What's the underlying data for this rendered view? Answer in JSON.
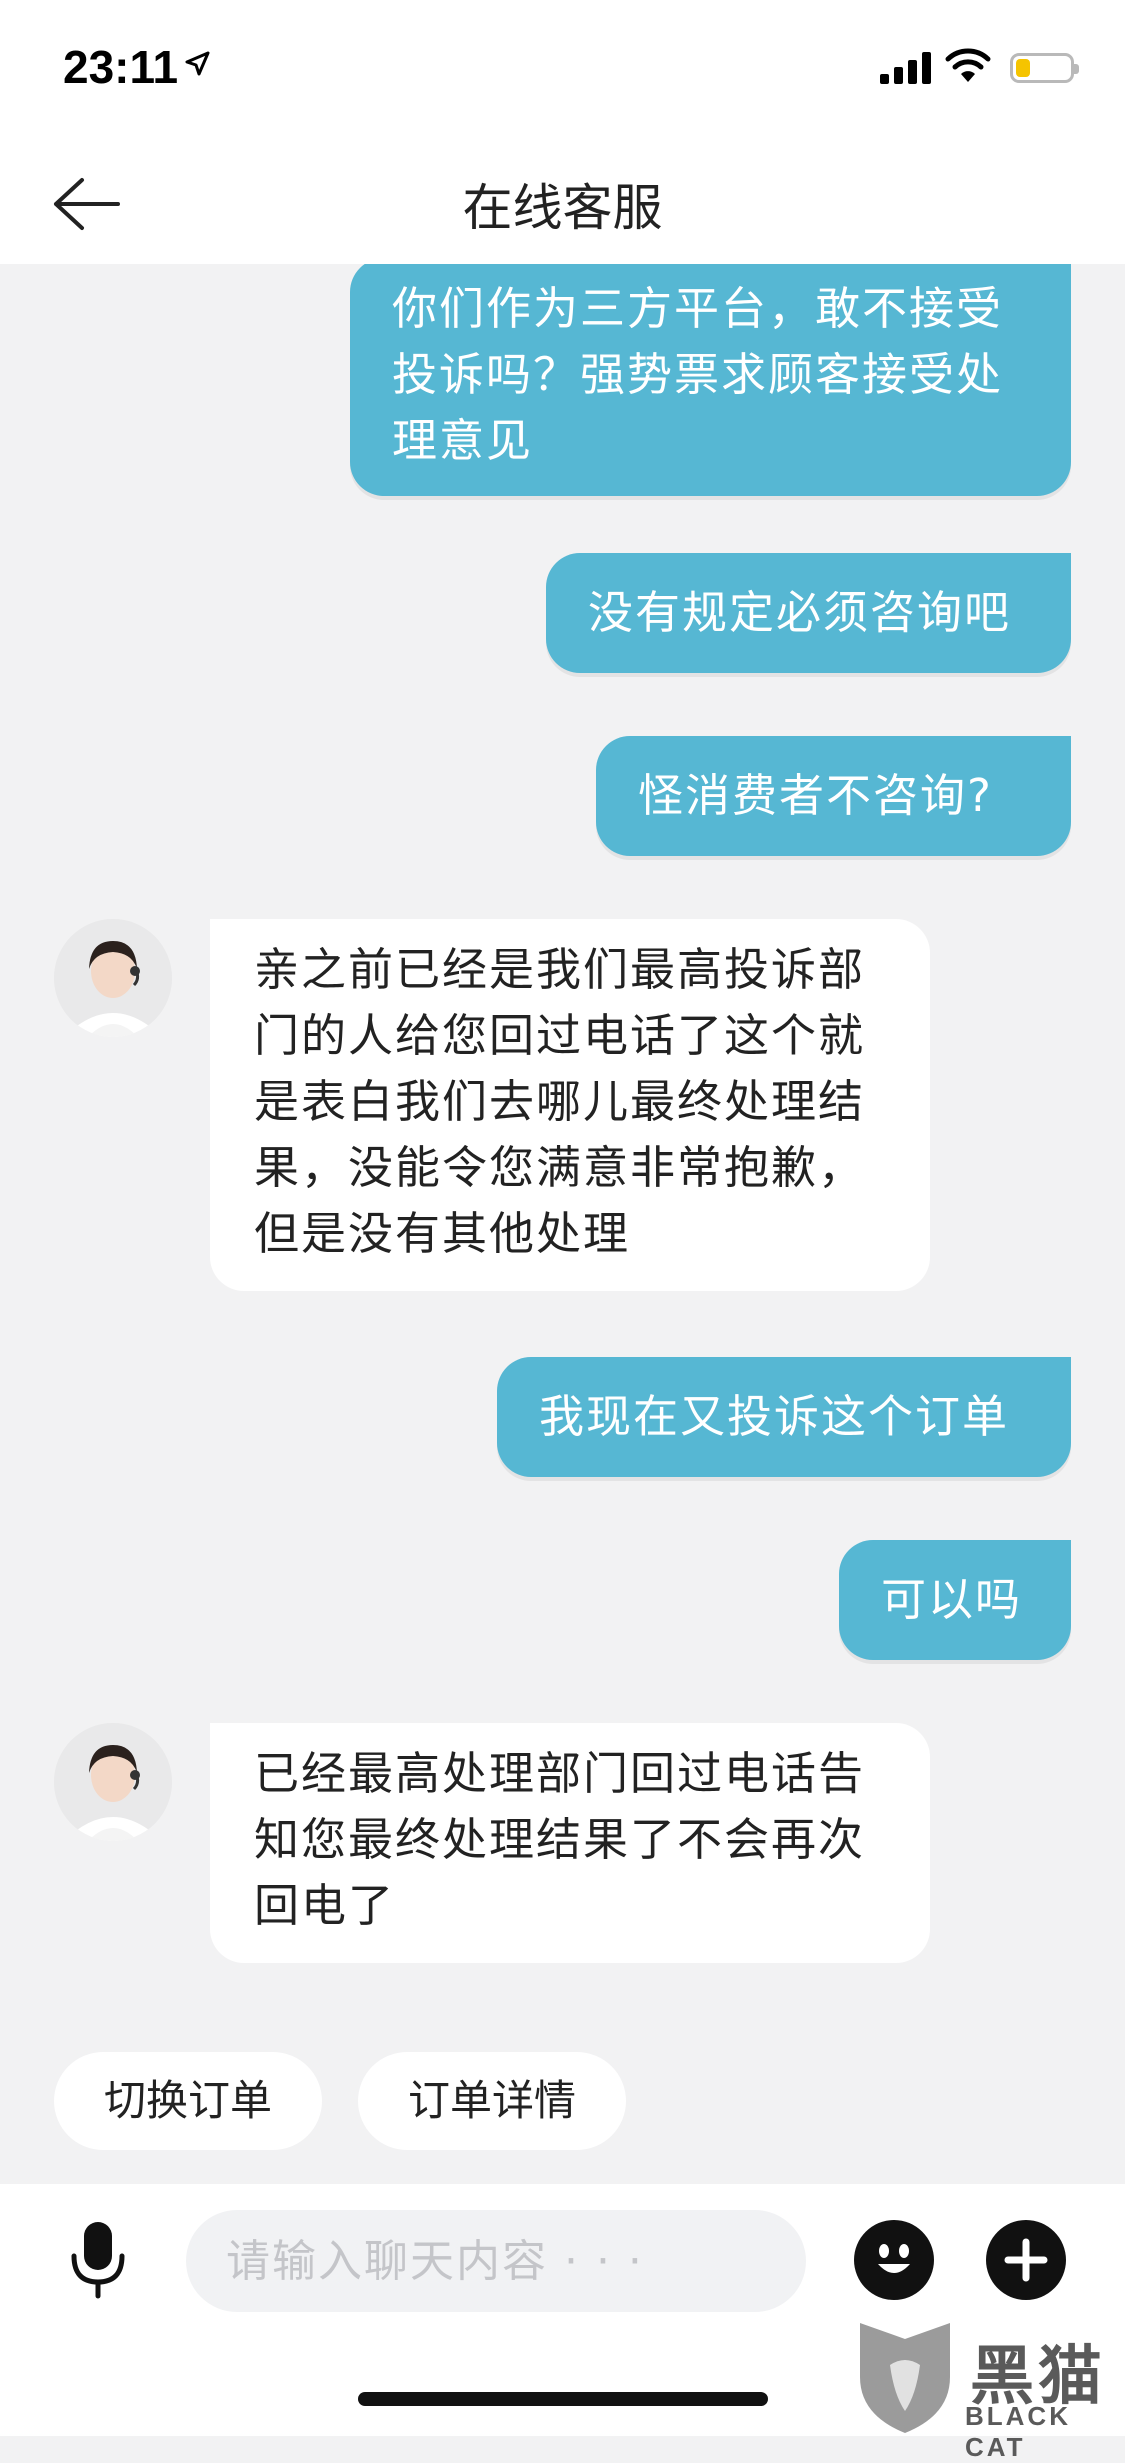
{
  "status_bar": {
    "time": "23:11"
  },
  "header": {
    "title": "在线客服"
  },
  "messages": [
    {
      "from": "user",
      "text": "你们作为三方平台，敢不接受投诉吗？强势票求顾客接受处理意见"
    },
    {
      "from": "user",
      "text": "没有规定必须咨询吧"
    },
    {
      "from": "user",
      "text": "怪消费者不咨询?"
    },
    {
      "from": "agent",
      "text": "亲之前已经是我们最高投诉部门的人给您回过电话了这个就是表白我们去哪儿最终处理结果，没能令您满意非常抱歉，但是没有其他处理"
    },
    {
      "from": "user",
      "text": "我现在又投诉这个订单"
    },
    {
      "from": "user",
      "text": "可以吗"
    },
    {
      "from": "agent",
      "text": "已经最高处理部门回过电话告知您最终处理结果了不会再次回电了"
    }
  ],
  "quick_actions": [
    {
      "label": "切换订单"
    },
    {
      "label": "订单详情"
    }
  ],
  "input": {
    "placeholder": "请输入聊天内容 · · ·",
    "value": ""
  },
  "watermark": {
    "cn": "黑猫",
    "en": "BLACK CAT"
  },
  "colors": {
    "outgoing_bubble": "#56b7d3",
    "background": "#f2f2f3",
    "battery": "#f5c400"
  }
}
